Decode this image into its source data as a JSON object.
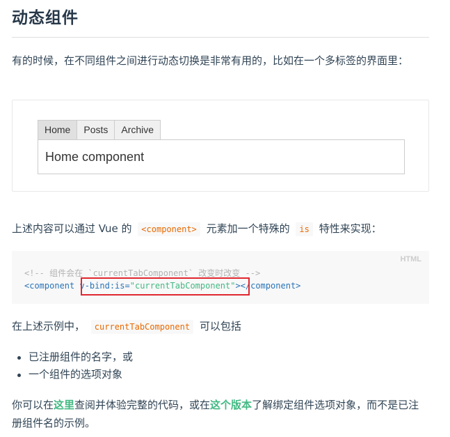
{
  "heading": "动态组件",
  "intro": "有的时候，在不同组件之间进行动态切换是非常有用的，比如在一个多标签的界面里：",
  "demo": {
    "tabs": [
      {
        "label": "Home",
        "active": true
      },
      {
        "label": "Posts",
        "active": false
      },
      {
        "label": "Archive",
        "active": false
      }
    ],
    "panel_text": "Home component"
  },
  "para2": {
    "before": "上述内容可以通过 Vue 的",
    "code1": "<component>",
    "middle": "元素加一个特殊的",
    "code2": "is",
    "after": "特性来实现："
  },
  "code_block": {
    "lang": "HTML",
    "line1": "<!-- 组件会在 `currentTabComponent` 改变时改变 -->",
    "line2_open": "<component ",
    "line2_attr": "v-bind:is",
    "line2_eq": "=",
    "line2_value": "\"currentTabComponent\"",
    "line2_close": "></component>"
  },
  "para3": {
    "before": "在上述示例中，",
    "code": "currentTabComponent",
    "after": "可以包括"
  },
  "bullets": [
    "已注册组件的名字，或",
    "一个组件的选项对象"
  ],
  "para4": {
    "part1": "你可以在",
    "link1": "这里",
    "part2": "查阅并体验完整的代码，或在",
    "link2": "这个版本",
    "part3": "了解绑定组件选项对象，而不是已注册组件名的示例。"
  },
  "colors": {
    "link": "#42b983",
    "inline_code": "#e96900",
    "highlight": "#e0272f"
  }
}
